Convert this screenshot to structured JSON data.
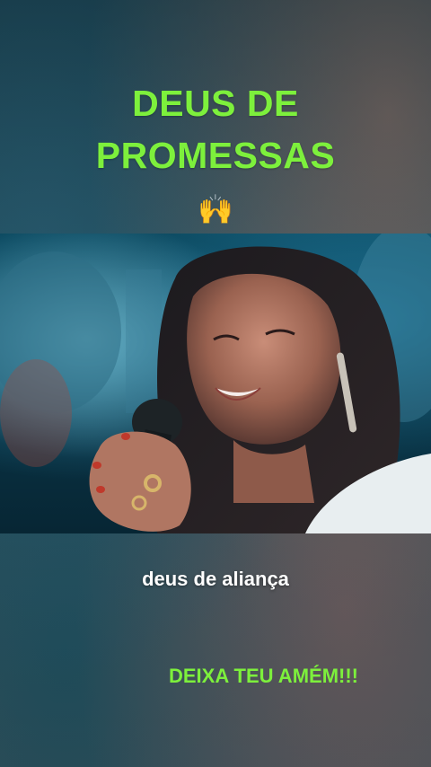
{
  "overlay": {
    "title_line1": "DEUS DE",
    "title_line2": "PROMESSAS",
    "emoji": "🙌",
    "subtitle": "deus de aliança",
    "cta": "DEIXA TEU AMÉM!!!"
  },
  "video": {
    "description_icon": "video-frame-singer"
  },
  "colors": {
    "title_green": "#7df03c",
    "subtitle_white": "#ffffff",
    "background_teal": "#1f4a58"
  }
}
